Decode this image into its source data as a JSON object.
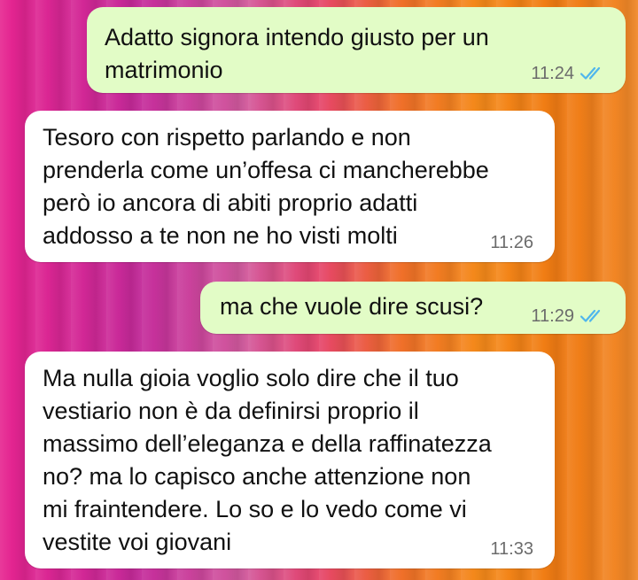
{
  "messages": [
    {
      "direction": "outgoing",
      "text": "Adatto signora intendo giusto per un\nmatrimonio",
      "time": "11:24",
      "status": "read"
    },
    {
      "direction": "incoming",
      "text": "Tesoro con rispetto parlando e non\nprenderla come un’offesa ci mancherebbe\nperò io ancora di abiti proprio adatti\naddosso a te non ne ho visti molti",
      "time": "11:26"
    },
    {
      "direction": "outgoing",
      "text": "ma che vuole dire scusi?",
      "time": "11:29",
      "status": "read"
    },
    {
      "direction": "incoming",
      "text": "Ma nulla gioia voglio solo dire che il tuo\nvestiario non è da definirsi proprio il\nmassimo dell’eleganza e della raffinatezza\nno? ma lo capisco anche attenzione non\nmi fraintendere. Lo so e lo vedo come vi\nvestite voi giovani",
      "time": "11:33"
    }
  ],
  "colors": {
    "outgoing_bubble": "#e2fcc6",
    "incoming_bubble": "#ffffff",
    "read_ticks": "#4fb6ec",
    "time_text": "#6b6b6b"
  },
  "icons": {
    "read_status": "double-check-icon"
  }
}
